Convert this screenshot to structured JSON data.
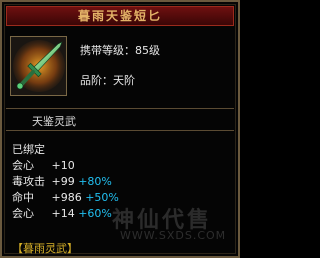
{
  "item": {
    "name": "暮雨天鉴短匕",
    "required_level": "携带等级：85级",
    "rank": "品阶：天阶",
    "icon": "dagger-icon"
  },
  "set": {
    "name": "天鉴灵武",
    "bound_status": "已绑定",
    "link_label": "【暮雨灵武】"
  },
  "stats": [
    {
      "label": "会心",
      "value": "+10",
      "bonus": ""
    },
    {
      "label": "毒攻击",
      "value": "+99",
      "bonus": "+80%"
    },
    {
      "label": "命中",
      "value": "+986",
      "bonus": "+50%"
    },
    {
      "label": "会心",
      "value": "+14",
      "bonus": "+60%"
    }
  ],
  "watermark": {
    "text": "神仙代售",
    "url": "WWW.SXDS.COM"
  },
  "colors": {
    "title_bar": "#6e1010",
    "title_text": "#e4b468",
    "bonus": "#22bff0",
    "set_link": "#d6b028",
    "border": "#6b5a3e"
  }
}
